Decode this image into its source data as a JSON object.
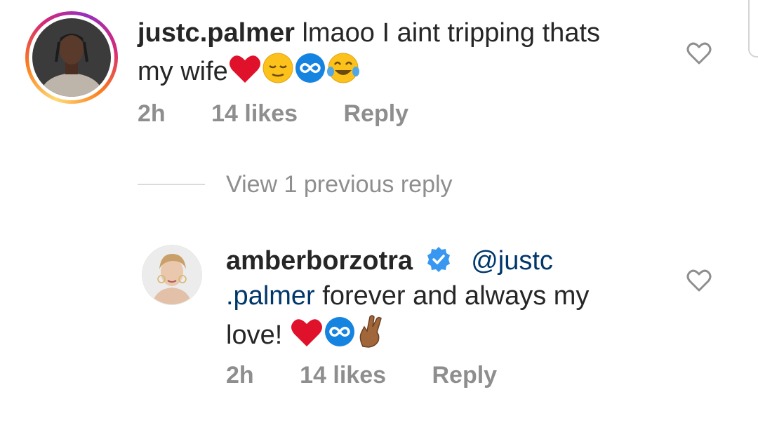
{
  "comments": [
    {
      "username": "justc.palmer",
      "text_line1": "lmaoo I aint tripping thats",
      "text_line2": "my wife",
      "emojis": [
        "red-heart",
        "relieved-face",
        "infinity",
        "tears-of-joy"
      ],
      "time": "2h",
      "likes": "14 likes",
      "reply_label": "Reply"
    },
    {
      "username": "amberborzotra",
      "verified": true,
      "mention_part1": "@justc",
      "mention_part2": ".palmer",
      "text_rest": " forever and always my",
      "text_line3": "love! ",
      "emojis": [
        "red-heart",
        "infinity",
        "crossed-fingers"
      ],
      "time": "2h",
      "likes": "14 likes",
      "reply_label": "Reply"
    }
  ],
  "view_previous": "View 1 previous reply",
  "colors": {
    "text": "#262626",
    "secondary": "#8e8e8e",
    "mention": "#00376b",
    "verified": "#3897f0",
    "heart": "#e0112b"
  }
}
